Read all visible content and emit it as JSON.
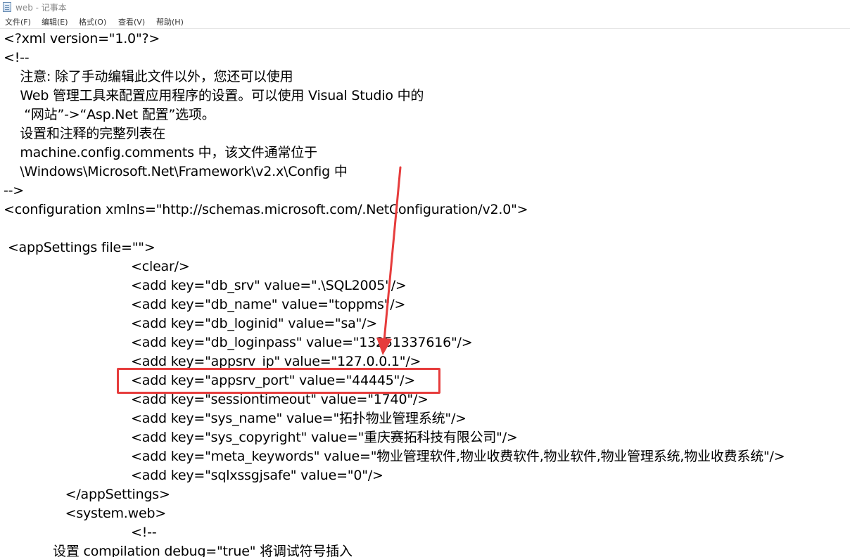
{
  "window": {
    "title": "web - 记事本",
    "icon": "notepad-icon"
  },
  "menu": {
    "items": [
      "文件(F)",
      "编辑(E)",
      "格式(O)",
      "查看(V)",
      "帮助(H)"
    ]
  },
  "editor": {
    "lines": [
      "<?xml version=\"1.0\"?>",
      "<!--",
      "    注意: 除了手动编辑此文件以外，您还可以使用",
      "    Web 管理工具来配置应用程序的设置。可以使用 Visual Studio 中的",
      "     “网站”->“Asp.Net 配置”选项。",
      "    设置和注释的完整列表在",
      "    machine.config.comments 中，该文件通常位于",
      "    \\Windows\\Microsoft.Net\\Framework\\v2.x\\Config 中",
      "-->",
      "<configuration xmlns=\"http://schemas.microsoft.com/.NetConfiguration/v2.0\">",
      "",
      " <appSettings file=\"\">",
      "                               <clear/>",
      "                               <add key=\"db_srv\" value=\".\\SQL2005\"/>",
      "                               <add key=\"db_name\" value=\"toppms\"/>",
      "                               <add key=\"db_loginid\" value=\"sa\"/>",
      "                               <add key=\"db_loginpass\" value=\"13251337616\"/>",
      "                               <add key=\"appsrv_ip\" value=\"127.0.0.1\"/>",
      "                               <add key=\"appsrv_port\" value=\"44445\"/>",
      "                               <add key=\"sessiontimeout\" value=\"1740\"/>",
      "                               <add key=\"sys_name\" value=\"拓扑物业管理系统\"/>",
      "                               <add key=\"sys_copyright\" value=\"重庆赛拓科技有限公司\"/>",
      "                               <add key=\"meta_keywords\" value=\"物业管理软件,物业收费软件,物业软件,物业管理系统,物业收费系统\"/>",
      "                               <add key=\"sqlxssgjsafe\" value=\"0\"/>",
      "               </appSettings>",
      "               <system.web>",
      "                               <!--",
      "            设置 compilation debug=\"true\" 将调试符号插入"
    ]
  },
  "annotation": {
    "color": "#e63c3c"
  }
}
